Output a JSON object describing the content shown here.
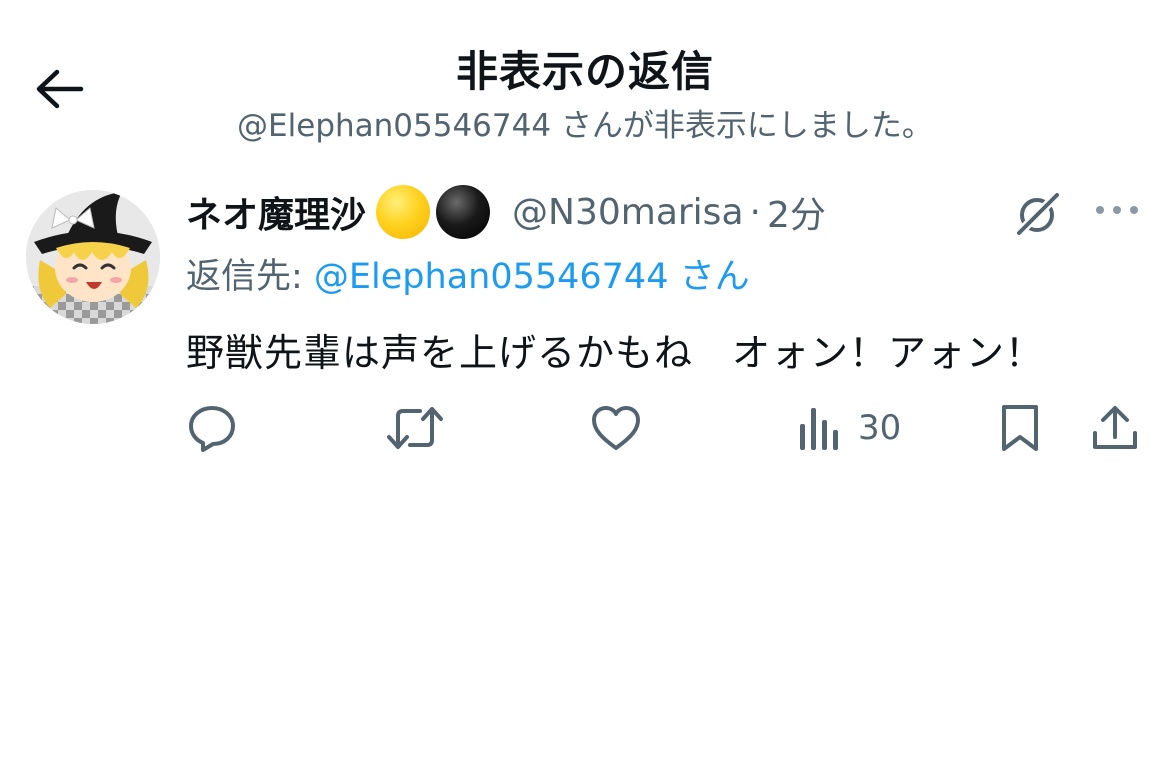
{
  "header": {
    "title": "非表示の返信",
    "subtitle": "@Elephan05546744 さんが非表示にしました。"
  },
  "tweet": {
    "display_name": "ネオ魔理沙",
    "name_emojis": [
      "yellow-circle",
      "black-circle"
    ],
    "handle": "@N30marisa",
    "separator": "·",
    "time": "2分",
    "reply_prefix": "返信先: ",
    "reply_target": "@Elephan05546744 さん",
    "text": "野獣先輩は声を上げるかもね　オォン！アォン！",
    "views": "30"
  },
  "colors": {
    "accent": "#1d9bf0",
    "text_primary": "#0f1419",
    "text_secondary": "#536471"
  },
  "icons": [
    "back-arrow-icon",
    "grok-icon",
    "more-icon",
    "reply-icon",
    "retweet-icon",
    "like-icon",
    "views-icon",
    "bookmark-icon",
    "share-icon"
  ]
}
